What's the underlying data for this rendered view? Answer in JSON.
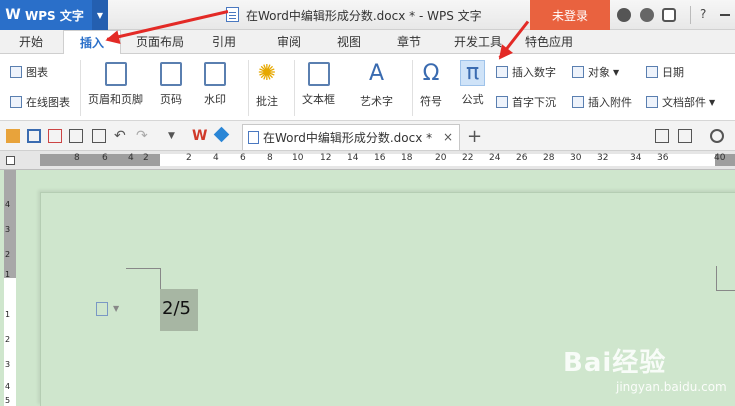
{
  "app": {
    "name": "WPS 文字",
    "window_title": "在Word中编辑形成分数.docx * - WPS 文字",
    "login": "未登录",
    "help": "?"
  },
  "tabs": [
    "开始",
    "插入",
    "页面布局",
    "引用",
    "审阅",
    "视图",
    "章节",
    "开发工具",
    "特色应用"
  ],
  "active_tab": "插入",
  "ribbon": {
    "chart": "图表",
    "online_chart": "在线图表",
    "header_footer": "页眉和页脚",
    "page_num": "页码",
    "watermark": "水印",
    "comment": "批注",
    "textbox": "文本框",
    "wordart": "艺术字",
    "symbol": "符号",
    "formula": "公式",
    "insert_number": "插入数字",
    "object": "对象",
    "date": "日期",
    "drop_cap": "首字下沉",
    "insert_attachment": "插入附件",
    "doc_parts": "文档部件"
  },
  "doc_tab": {
    "label": "在Word中编辑形成分数.docx *",
    "close": "×",
    "new": "+"
  },
  "ruler": {
    "top_numbers": [
      "8",
      "6",
      "4",
      "2",
      "2",
      "4",
      "6",
      "8",
      "10",
      "12",
      "14",
      "16",
      "18",
      "20",
      "22",
      "24",
      "26",
      "28",
      "30",
      "32",
      "34",
      "36",
      "40"
    ],
    "side_numbers": [
      "4",
      "3",
      "2",
      "1",
      "1",
      "2",
      "3",
      "4",
      "5"
    ]
  },
  "document": {
    "content": "2/5"
  },
  "colors": {
    "accent": "#2a6fc9",
    "login_bg": "#e9623f",
    "arrow": "#e32a26",
    "page_bg": "#cfe6cd"
  },
  "watermark": {
    "brand": "Bai经验",
    "url": "jingyan.baidu.com"
  }
}
